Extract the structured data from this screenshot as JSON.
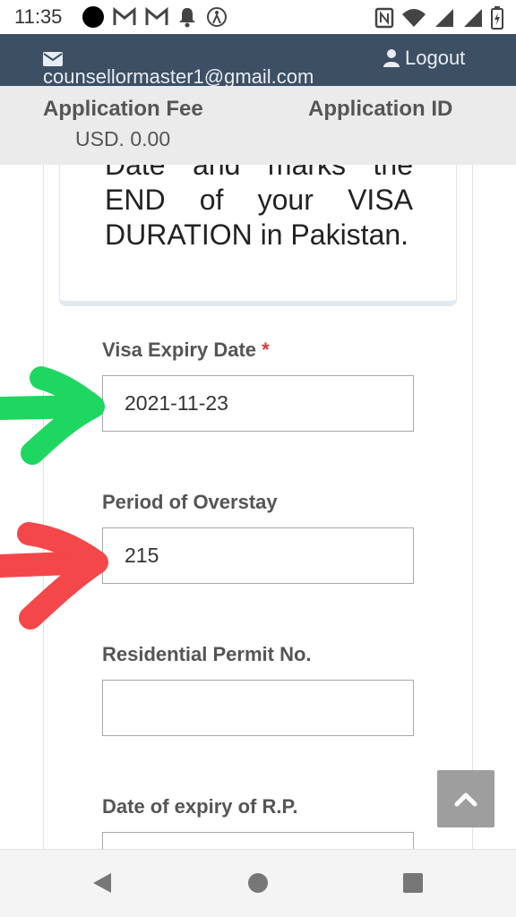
{
  "status_bar": {
    "time": "11:35",
    "left_icons": [
      "black-dot-icon",
      "gmail-icon",
      "gmail-icon",
      "notification-bell-icon",
      "accessibility-icon"
    ],
    "right_icons": [
      "nfc-icon",
      "wifi-icon",
      "signal-icon",
      "signal-icon",
      "battery-charging-icon"
    ]
  },
  "header": {
    "email": "counsellormaster1@gmail.com",
    "logout_label": "Logout"
  },
  "fee_bar": {
    "fee_label": "Application Fee",
    "fee_value": "USD. 0.00",
    "app_id_label": "Application ID"
  },
  "note": {
    "text": "Date and marks the END of your VISA DURATION in Pakistan."
  },
  "form": {
    "visa_expiry": {
      "label": "Visa Expiry Date",
      "required_mark": "*",
      "value": "2021-11-23"
    },
    "overstay": {
      "label": "Period of Overstay",
      "value": "215"
    },
    "permit_no": {
      "label": "Residential Permit No.",
      "value": ""
    },
    "permit_expiry": {
      "label": "Date of expiry of R.P.",
      "value": ""
    }
  },
  "colors": {
    "header_bg": "#3d4f63",
    "fee_bar_bg": "#ebebeb",
    "green_arrow": "#1ed760",
    "red_arrow": "#f4474a",
    "required": "#d43d3d"
  }
}
